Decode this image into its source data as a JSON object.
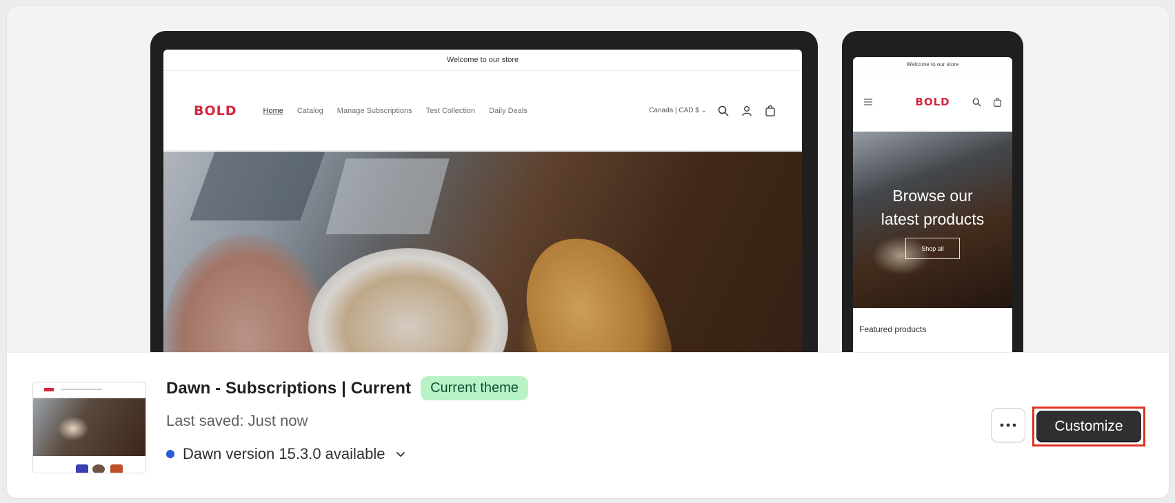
{
  "desktop_preview": {
    "announcement": "Welcome to our store",
    "logo": "BOLD",
    "nav": [
      "Home",
      "Catalog",
      "Manage Subscriptions",
      "Test Collection",
      "Daily Deals"
    ],
    "country": "Canada | CAD $"
  },
  "mobile_preview": {
    "announcement": "Welcome to our store",
    "logo": "BOLD",
    "hero_line1": "Browse our",
    "hero_line2": "latest products",
    "shop_all": "Shop all",
    "featured": "Featured products"
  },
  "theme": {
    "name": "Dawn - Subscriptions | Current",
    "badge": "Current theme",
    "last_saved": "Last saved: Just now",
    "version_notice": "Dawn version 15.3.0 available"
  },
  "actions": {
    "more_label": "···",
    "customize_label": "Customize"
  },
  "colors": {
    "brand_red": "#d7263d",
    "badge_bg": "#b8f3c6",
    "badge_text": "#0c5132",
    "version_dot": "#2c59d6",
    "highlight": "#e0301e"
  }
}
